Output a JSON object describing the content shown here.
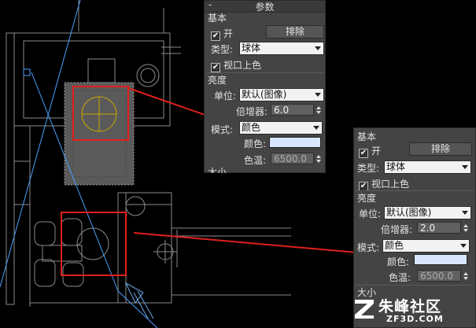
{
  "panel_back": {
    "collapse_symbol": "-",
    "title": "参数",
    "basic_section": "基本",
    "on_label": "开",
    "exclude_button": "排除",
    "type_label": "类型:",
    "type_value": "球体",
    "viewport_shading_label": "视口上色",
    "brightness_section": "亮度",
    "unit_label": "单位:",
    "unit_value": "默认(图像)",
    "multiplier_label": "倍增器:",
    "multiplier_value": "6.0",
    "mode_label": "模式:",
    "mode_value": "颜色",
    "color_label": "颜色:",
    "color_temp_label": "色温:",
    "color_temp_value": "6500.0",
    "size_section": "大小",
    "swatch_color": "#d8e6ff"
  },
  "panel_front": {
    "basic_section": "基本",
    "on_label": "开",
    "exclude_button": "排除",
    "type_label": "类型:",
    "type_value": "球体",
    "viewport_shading_label": "视口上色",
    "brightness_section": "亮度",
    "unit_label": "单位:",
    "unit_value": "默认(图像)",
    "multiplier_label": "倍增器:",
    "multiplier_value": "2.0",
    "mode_label": "模式:",
    "mode_value": "颜色",
    "color_label": "颜色:",
    "color_temp_label": "色温:",
    "color_temp_value": "6500.0",
    "size_section": "大小",
    "swatch_color": "#d8e6ff"
  },
  "watermark": {
    "brand_cn": "朱峰社区",
    "brand_en": "ZF3D.COM"
  },
  "colors": {
    "annotation_red": "#e0201c",
    "wireframe": "#8a8a8a",
    "light_line": "#4aa0ff",
    "panel_bg": "#444444"
  }
}
